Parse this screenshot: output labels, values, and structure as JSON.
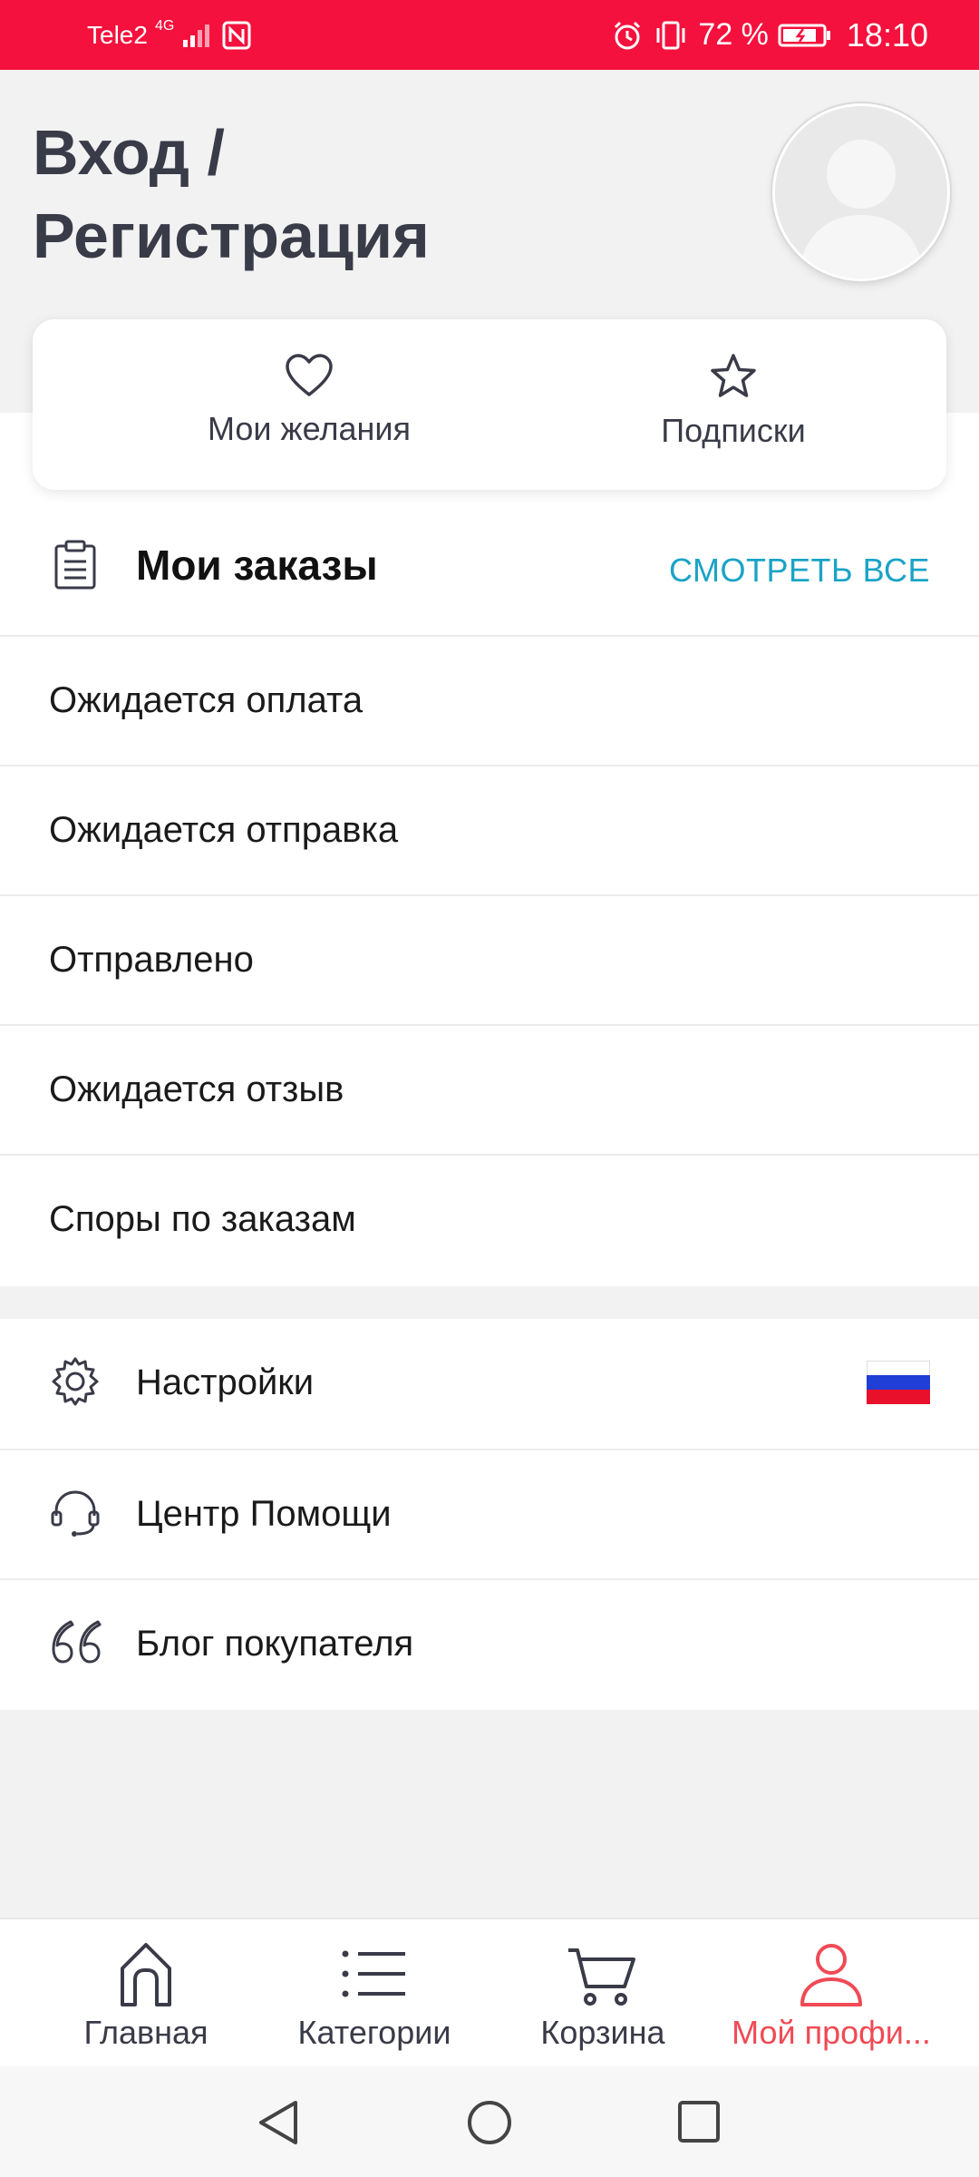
{
  "status_bar": {
    "carrier": "Tele2",
    "network": "4G",
    "battery_percent": "72 %",
    "time": "18:10"
  },
  "header": {
    "title": "Вход /\nРегистрация"
  },
  "quick_actions": [
    {
      "label": "Мои желания",
      "icon": "heart-icon"
    },
    {
      "label": "Подписки",
      "icon": "star-icon"
    }
  ],
  "orders": {
    "title": "Мои заказы",
    "view_all": "СМОТРЕТЬ ВСЕ",
    "items": [
      "Ожидается оплата",
      "Ожидается отправка",
      "Отправлено",
      "Ожидается отзыв",
      "Споры по заказам"
    ]
  },
  "menu": {
    "settings": "Настройки",
    "help": "Центр Помощи",
    "blog": "Блог покупателя"
  },
  "tabbar": {
    "home": "Главная",
    "categories": "Категории",
    "cart": "Корзина",
    "profile": "Мой профи..."
  },
  "colors": {
    "status_bar": "#f5113d",
    "accent_link": "#1aa3c6",
    "active_tab": "#f04a55"
  }
}
